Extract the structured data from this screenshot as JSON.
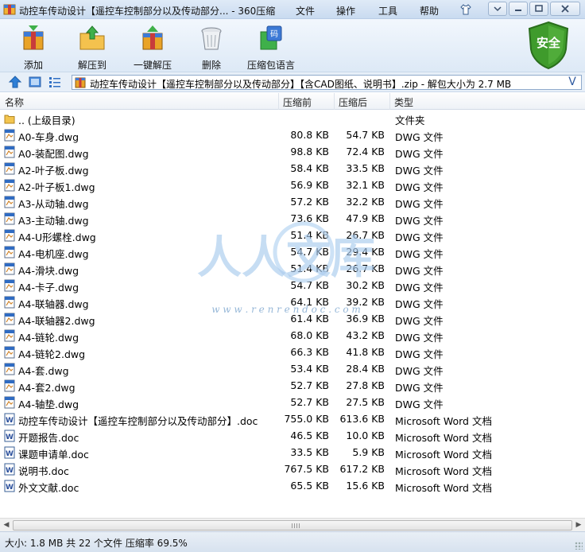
{
  "window": {
    "title": "动控车传动设计【遥控车控制部分以及传动部分... - 360压缩",
    "menus": [
      "文件",
      "操作",
      "工具",
      "帮助"
    ]
  },
  "toolbar": {
    "add": "添加",
    "extract_to": "解压到",
    "one_click_extract": "一键解压",
    "delete": "删除",
    "comment_language": "压缩包语言",
    "safe_badge": "安全",
    "safe_color": "#3f9b2c"
  },
  "address": {
    "path": "动控车传动设计【遥控车控制部分以及传动部分】【含CAD图纸、说明书】.zip - 解包大小为 2.7 MB"
  },
  "columns": {
    "name": "名称",
    "size": "压缩前",
    "compressed": "压缩后",
    "type": "类型"
  },
  "files": [
    {
      "name": ".. (上级目录)",
      "size": "",
      "csize": "",
      "type": "文件夹",
      "kind": "folder"
    },
    {
      "name": "A0-车身.dwg",
      "size": "80.8 KB",
      "csize": "54.7 KB",
      "type": "DWG 文件",
      "kind": "dwg"
    },
    {
      "name": "A0-装配图.dwg",
      "size": "98.8 KB",
      "csize": "72.4 KB",
      "type": "DWG 文件",
      "kind": "dwg"
    },
    {
      "name": "A2-叶子板.dwg",
      "size": "58.4 KB",
      "csize": "33.5 KB",
      "type": "DWG 文件",
      "kind": "dwg"
    },
    {
      "name": "A2-叶子板1.dwg",
      "size": "56.9 KB",
      "csize": "32.1 KB",
      "type": "DWG 文件",
      "kind": "dwg"
    },
    {
      "name": "A3-从动轴.dwg",
      "size": "57.2 KB",
      "csize": "32.2 KB",
      "type": "DWG 文件",
      "kind": "dwg"
    },
    {
      "name": "A3-主动轴.dwg",
      "size": "73.6 KB",
      "csize": "47.9 KB",
      "type": "DWG 文件",
      "kind": "dwg"
    },
    {
      "name": "A4-U形螺栓.dwg",
      "size": "51.4 KB",
      "csize": "26.7 KB",
      "type": "DWG 文件",
      "kind": "dwg"
    },
    {
      "name": "A4-电机座.dwg",
      "size": "54.7 KB",
      "csize": "29.4 KB",
      "type": "DWG 文件",
      "kind": "dwg"
    },
    {
      "name": "A4-滑块.dwg",
      "size": "51.4 KB",
      "csize": "26.7 KB",
      "type": "DWG 文件",
      "kind": "dwg"
    },
    {
      "name": "A4-卡子.dwg",
      "size": "54.7 KB",
      "csize": "30.2 KB",
      "type": "DWG 文件",
      "kind": "dwg"
    },
    {
      "name": "A4-联轴器.dwg",
      "size": "64.1 KB",
      "csize": "39.2 KB",
      "type": "DWG 文件",
      "kind": "dwg"
    },
    {
      "name": "A4-联轴器2.dwg",
      "size": "61.4 KB",
      "csize": "36.9 KB",
      "type": "DWG 文件",
      "kind": "dwg"
    },
    {
      "name": "A4-链轮.dwg",
      "size": "68.0 KB",
      "csize": "43.2 KB",
      "type": "DWG 文件",
      "kind": "dwg"
    },
    {
      "name": "A4-链轮2.dwg",
      "size": "66.3 KB",
      "csize": "41.8 KB",
      "type": "DWG 文件",
      "kind": "dwg"
    },
    {
      "name": "A4-套.dwg",
      "size": "53.4 KB",
      "csize": "28.4 KB",
      "type": "DWG 文件",
      "kind": "dwg"
    },
    {
      "name": "A4-套2.dwg",
      "size": "52.7 KB",
      "csize": "27.8 KB",
      "type": "DWG 文件",
      "kind": "dwg"
    },
    {
      "name": "A4-轴垫.dwg",
      "size": "52.7 KB",
      "csize": "27.5 KB",
      "type": "DWG 文件",
      "kind": "dwg"
    },
    {
      "name": "动控车传动设计【遥控车控制部分以及传动部分】.doc",
      "size": "755.0 KB",
      "csize": "613.6 KB",
      "type": "Microsoft Word 文档",
      "kind": "doc"
    },
    {
      "name": "开题报告.doc",
      "size": "46.5 KB",
      "csize": "10.0 KB",
      "type": "Microsoft Word 文档",
      "kind": "doc"
    },
    {
      "name": "课题申请单.doc",
      "size": "33.5 KB",
      "csize": "5.9 KB",
      "type": "Microsoft Word 文档",
      "kind": "doc"
    },
    {
      "name": "说明书.doc",
      "size": "767.5 KB",
      "csize": "617.2 KB",
      "type": "Microsoft Word 文档",
      "kind": "doc"
    },
    {
      "name": "外文文献.doc",
      "size": "65.5 KB",
      "csize": "15.6 KB",
      "type": "Microsoft Word 文档",
      "kind": "doc"
    }
  ],
  "watermark": {
    "text": "人人文库",
    "url": "w w w . r e n r e n d o c . c o m"
  },
  "status": {
    "text": "大小: 1.8 MB 共 22 个文件 压缩率 69.5%"
  }
}
